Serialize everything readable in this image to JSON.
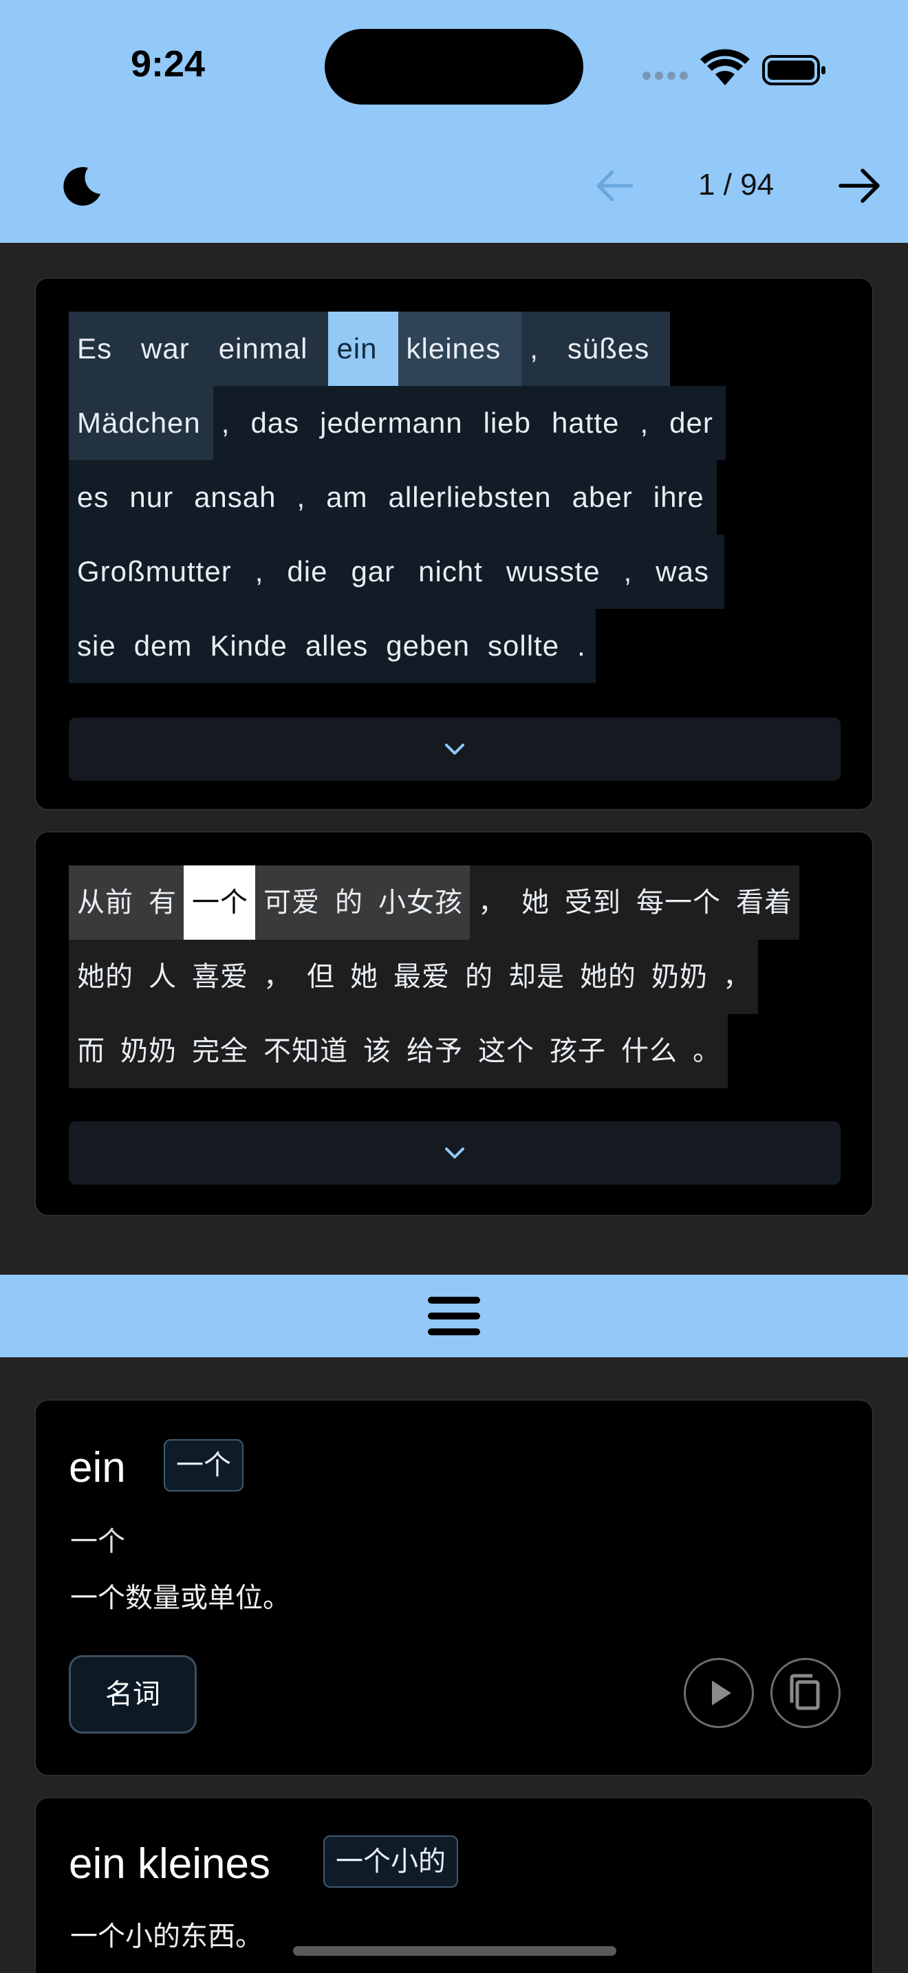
{
  "status": {
    "time": "9:24"
  },
  "nav": {
    "page": "1 / 94"
  },
  "german": {
    "rows": [
      [
        {
          "t": "Es",
          "k": "mid"
        },
        {
          "t": "war",
          "k": "mid"
        },
        {
          "t": "einmal",
          "k": "mid"
        },
        {
          "t": "ein",
          "k": "sel"
        },
        {
          "t": "kleines",
          "k": "soft"
        },
        {
          "t": ",",
          "k": "mid"
        },
        {
          "t": "süßes",
          "k": "mid"
        }
      ],
      [
        {
          "t": "Mädchen",
          "k": "mid"
        },
        {
          "t": ",",
          "k": ""
        },
        {
          "t": "das",
          "k": ""
        },
        {
          "t": "jedermann",
          "k": ""
        },
        {
          "t": "lieb",
          "k": ""
        },
        {
          "t": "hatte",
          "k": ""
        },
        {
          "t": ",",
          "k": ""
        },
        {
          "t": "der",
          "k": ""
        }
      ],
      [
        {
          "t": "es",
          "k": ""
        },
        {
          "t": "nur",
          "k": ""
        },
        {
          "t": "ansah",
          "k": ""
        },
        {
          "t": ",",
          "k": ""
        },
        {
          "t": "am",
          "k": ""
        },
        {
          "t": "allerliebsten",
          "k": ""
        },
        {
          "t": "aber",
          "k": ""
        },
        {
          "t": "ihre",
          "k": ""
        }
      ],
      [
        {
          "t": "Großmutter",
          "k": ""
        },
        {
          "t": ",",
          "k": ""
        },
        {
          "t": "die",
          "k": ""
        },
        {
          "t": "gar",
          "k": ""
        },
        {
          "t": "nicht",
          "k": ""
        },
        {
          "t": "wusste",
          "k": ""
        },
        {
          "t": ",",
          "k": ""
        },
        {
          "t": "was",
          "k": ""
        }
      ],
      [
        {
          "t": "sie",
          "k": ""
        },
        {
          "t": "dem",
          "k": ""
        },
        {
          "t": "Kinde",
          "k": ""
        },
        {
          "t": "alles",
          "k": ""
        },
        {
          "t": "geben",
          "k": ""
        },
        {
          "t": "sollte",
          "k": ""
        },
        {
          "t": ".",
          "k": ""
        }
      ]
    ]
  },
  "chinese": {
    "rows": [
      [
        {
          "t": "从前",
          "k": "mid"
        },
        {
          "t": "有",
          "k": "mid"
        },
        {
          "t": "一个",
          "k": "sel"
        },
        {
          "t": "可爱",
          "k": "mid"
        },
        {
          "t": "的",
          "k": "mid"
        },
        {
          "t": "小女孩",
          "k": "mid"
        },
        {
          "t": "，",
          "k": ""
        },
        {
          "t": "她",
          "k": ""
        },
        {
          "t": "受到",
          "k": ""
        },
        {
          "t": "每一个",
          "k": ""
        },
        {
          "t": "看着",
          "k": ""
        }
      ],
      [
        {
          "t": "她的",
          "k": ""
        },
        {
          "t": "人",
          "k": ""
        },
        {
          "t": "喜爱",
          "k": ""
        },
        {
          "t": "，",
          "k": ""
        },
        {
          "t": "但",
          "k": ""
        },
        {
          "t": "她",
          "k": ""
        },
        {
          "t": "最爱",
          "k": ""
        },
        {
          "t": "的",
          "k": ""
        },
        {
          "t": "却是",
          "k": ""
        },
        {
          "t": "她的",
          "k": ""
        },
        {
          "t": "奶奶",
          "k": ""
        },
        {
          "t": "，",
          "k": ""
        }
      ],
      [
        {
          "t": "而",
          "k": ""
        },
        {
          "t": "奶奶",
          "k": ""
        },
        {
          "t": "完全",
          "k": ""
        },
        {
          "t": "不知道",
          "k": ""
        },
        {
          "t": "该",
          "k": ""
        },
        {
          "t": "给予",
          "k": ""
        },
        {
          "t": "这个",
          "k": ""
        },
        {
          "t": "孩子",
          "k": ""
        },
        {
          "t": "什么",
          "k": ""
        },
        {
          "t": "。",
          "k": ""
        }
      ]
    ]
  },
  "entries": [
    {
      "word": "ein",
      "translation": "一个",
      "meaning": "一个",
      "description": "一个数量或单位。",
      "pos": "名词"
    },
    {
      "word": "ein kleines",
      "translation": "一个小的",
      "description": "一个小的东西。"
    }
  ],
  "icons": {
    "theme": "moon-icon",
    "prev": "arrow-left-icon",
    "next": "arrow-right-icon",
    "expand": "chevron-down-icon",
    "menu": "menu-icon",
    "play": "play-icon",
    "copy": "copy-icon"
  }
}
